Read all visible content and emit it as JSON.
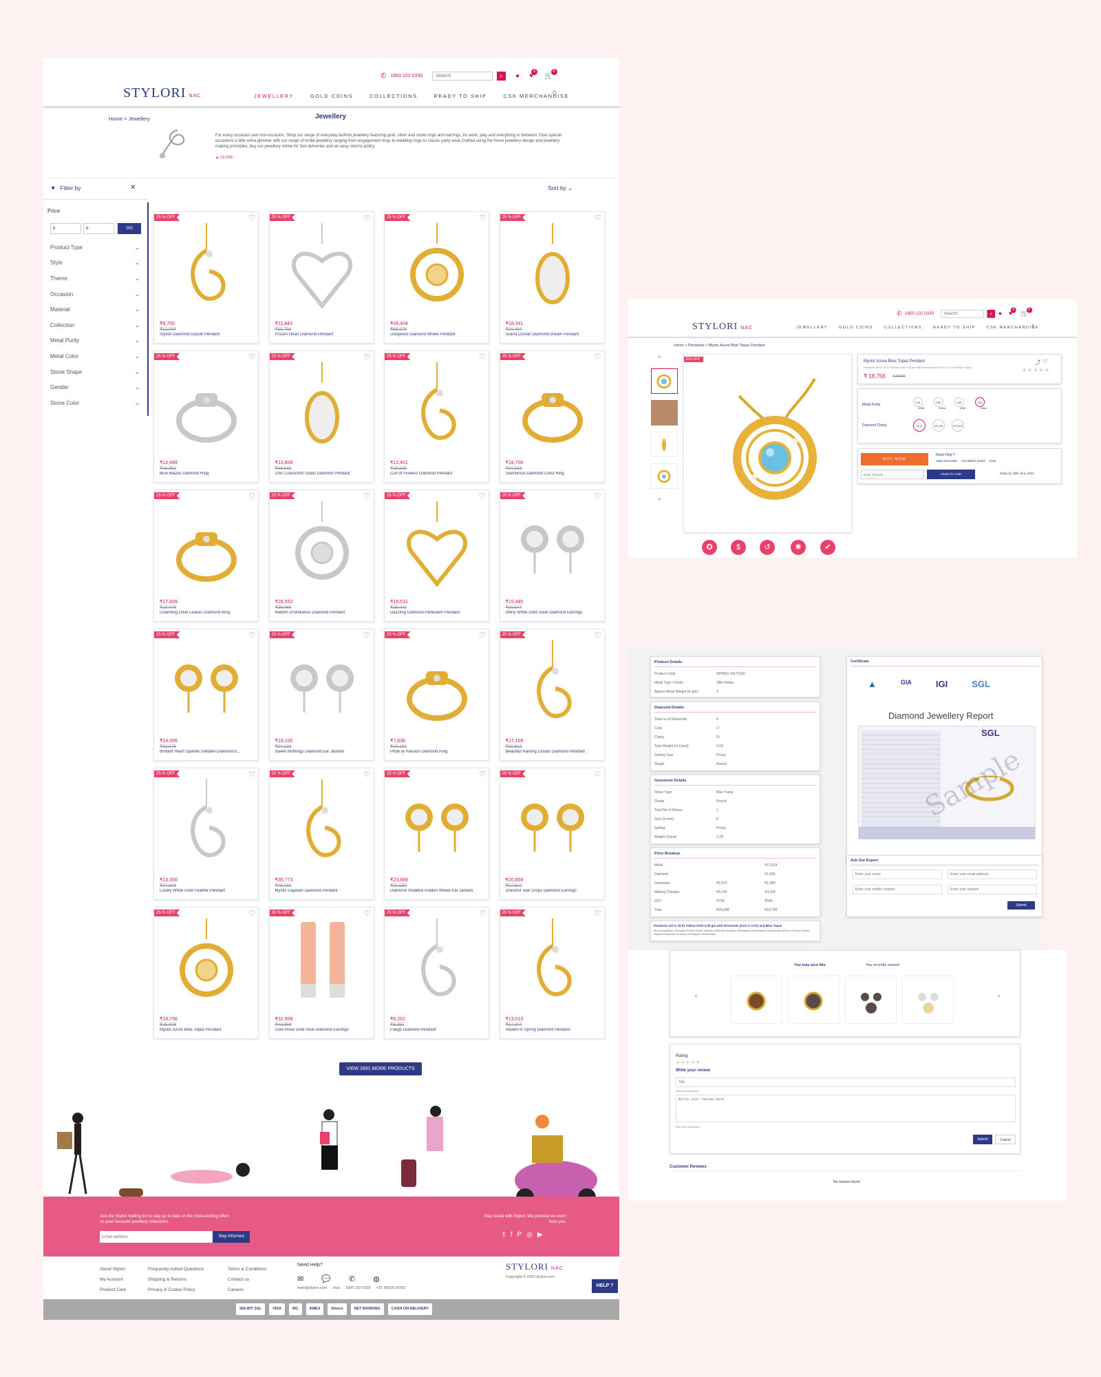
{
  "header": {
    "logo": "STYLORI",
    "logo_sub": "NAC",
    "phone": "1800 102 0330",
    "search_placeholder": "Search",
    "wishlist_count": "0",
    "cart_count": "0",
    "nav": [
      "JEWELLERY",
      "GOLD COINS",
      "COLLECTIONS",
      "READY TO SHIP",
      "CSK MERCHANDISE"
    ]
  },
  "breadcrumb": {
    "home": "Home",
    "current": "Jewellery"
  },
  "intro": {
    "title": "Jewellery",
    "text": "For every occasion and non-occasion. Shop our range of everyday fashion jewellery featuring gold, silver and stone rings and earrings, for work, play and everything in between. Give special occasions a little extra glimmer with our range of bridal jewellery ranging from engagement rings to wedding rings to classic party wear.Crafted using the finest jewellery design and jewellery making principles, buy our jewellery online for fast deliveries and an easy returns policy.",
    "close": "CLOSE"
  },
  "filter": {
    "title": "Filter by",
    "sort": "Sort by",
    "price_label": "Price",
    "min": "0",
    "max": "0",
    "go": "GO",
    "items": [
      "Product Type",
      "Style",
      "Theme",
      "Occasion",
      "Material",
      "Collection",
      "Metal Purity",
      "Metal Color",
      "Stone Shape",
      "Gender",
      "Stone Color"
    ]
  },
  "products": [
    {
      "off": "25 % OFF",
      "price": "₹9,700",
      "mrp": "₹12,934",
      "name": "Stylish Diamond Dazzle Pendant",
      "art": "pendant"
    },
    {
      "off": "25 % OFF",
      "price": "₹11,843",
      "mrp": "₹15,791",
      "name": "Frozen Heart Diamond Pendant",
      "art": "heart-silver"
    },
    {
      "off": "25 % OFF",
      "price": "₹49,404",
      "mrp": "₹65,979",
      "name": "Gorgeous Diamond Wheel Pendant",
      "art": "round"
    },
    {
      "off": "25 % OFF",
      "price": "₹18,341",
      "mrp": "₹24,454",
      "name": "Grand Cluster Diamond Dream Pendant",
      "art": "oval"
    },
    {
      "off": "25 % OFF",
      "price": "₹12,489",
      "mrp": "₹16,652",
      "name": "Blue Blazes Diamond Ring",
      "art": "ring-silver"
    },
    {
      "off": "25 % OFF",
      "price": "₹13,809",
      "mrp": "₹18,632",
      "name": "Chic Concentric Ovals Diamond Pendant",
      "art": "oval"
    },
    {
      "off": "25 % OFF",
      "price": "₹12,401",
      "mrp": "₹16,535",
      "name": "Curl of Flowers Diamond Pendant",
      "art": "pendant"
    },
    {
      "off": "25 % OFF",
      "price": "₹18,700",
      "mrp": "₹24,933",
      "name": "Glamorous Diamond Crest Ring",
      "art": "ring"
    },
    {
      "off": "25 % OFF",
      "price": "₹17,609",
      "mrp": "₹23,478",
      "name": "Charming Olive Leaves Diamond Ring",
      "art": "ring"
    },
    {
      "off": "25 % OFF",
      "price": "₹28,552",
      "mrp": "₹38,069",
      "name": "Rebirth of Brilliance Diamond Pendant",
      "art": "round-silver"
    },
    {
      "off": "25 % OFF",
      "price": "₹19,531",
      "mrp": "₹26,042",
      "name": "Dazzling Diamond Pendulum Pendant",
      "art": "heart"
    },
    {
      "off": "25 % OFF",
      "price": "₹15,485",
      "mrp": "₹20,647",
      "name": "Shiny White Gold Solar Diamond Earrings",
      "art": "earring-silver"
    },
    {
      "off": "25 % OFF",
      "price": "₹24,056",
      "mrp": "₹32,075",
      "name": "Brilliant Heart Sparkle Solitaire Diamond E...",
      "art": "earring"
    },
    {
      "off": "25 % OFF",
      "price": "₹18,100",
      "mrp": "₹24,133",
      "name": "Sweet Nothings Diamond Ear Jackets",
      "art": "earring-silver"
    },
    {
      "off": "25 % OFF",
      "price": "₹7,636",
      "mrp": "₹10,182",
      "name": "Pride of Passion Diamond Ring",
      "art": "ring"
    },
    {
      "off": "25 % OFF",
      "price": "₹17,109",
      "mrp": "₹22,812",
      "name": "Beautiful Raining Clouds Diamond Pendant",
      "art": "pendant"
    },
    {
      "off": "25 % OFF",
      "price": "₹13,356",
      "mrp": "₹17,808",
      "name": "Lovely White Gold Feather Pendant",
      "art": "pendant-silver"
    },
    {
      "off": "25 % OFF",
      "price": "₹35,773",
      "mrp": "₹48,031",
      "name": "Mystic Gajanan Diamond Pendant",
      "art": "pendant"
    },
    {
      "off": "25 % OFF",
      "price": "₹23,669",
      "mrp": "₹31,559",
      "name": "Diamond Studded Golden Wheel Ear Jackets",
      "art": "earring"
    },
    {
      "off": "25 % OFF",
      "price": "₹20,859",
      "mrp": "₹27,812",
      "name": "Graceful Tear Drops Diamond Earrings",
      "art": "earring"
    },
    {
      "off": "25 % OFF",
      "price": "₹18,756",
      "mrp": "₹25,008",
      "name": "Mystic Azure Blue Topaz Pendant",
      "art": "round"
    },
    {
      "off": "25 % OFF",
      "price": "₹32,909",
      "mrp": "₹43,959",
      "name": "Cute Rose Gold Stick Diamond Earrings",
      "art": "stick"
    },
    {
      "off": "25 % OFF",
      "price": "₹6,262",
      "mrp": "₹8,350",
      "name": "Fuego Diamond Pendant",
      "art": "pendant-silver"
    },
    {
      "off": "25 % OFF",
      "price": "₹13,010",
      "mrp": "₹17,347",
      "name": "Advent of Spring Diamond Pendant",
      "art": "pendant"
    }
  ],
  "more_button": "VIEW 2691 MORE PRODUCTS",
  "newsletter": {
    "text": "Join the Stylori mailing list to stay up to date on the most exciting offers on your favourite jewellery collections",
    "placeholder": "Email address",
    "button": "Stay Informed",
    "social_text": "Stay social with Stylori. We promise we won't bore you."
  },
  "footer": {
    "col1": [
      "About Stylori",
      "My Account",
      "Product Care"
    ],
    "col2": [
      "Frequently Asked Questions",
      "Shipping & Returns",
      "Privacy & Cookie Policy"
    ],
    "col3": [
      "Terms & Conditions",
      "Contact us",
      "Careers"
    ],
    "help_title": "Need Help?",
    "contacts": [
      "hello@stylori.com",
      "chat",
      "1800 102 0330",
      "+91 99526 25252"
    ],
    "copyright": "Copyright © 2020 stylori.com",
    "help_btn": "HELP ?",
    "payments": [
      "256-BIT SSL",
      "VISA",
      "MC",
      "AMEX",
      "Diners",
      "NET BANKING",
      "CASH ON DELIVERY"
    ]
  },
  "pdp": {
    "breadcrumb": [
      "Home",
      "Pendants",
      "Mystic Azure Blue Topaz Pendant"
    ],
    "off": "25% OFF",
    "title": "Mystic Azure Blue Topaz Pendant",
    "subtitle": "Pendants set in 18 Kt Yellow Gold 3.00 gm with Diamonds (0.03 ct U-IC) and Blue Topaz",
    "price": "₹ 18,756",
    "mrp": "₹ 25008",
    "metal_purity_label": "Metal Purity",
    "purity": [
      "14K",
      "18K",
      "18K",
      "18K"
    ],
    "purity_colors": [
      "White",
      "Yellow",
      "White",
      "Yellow"
    ],
    "clarity_label": "Diamond Clarity",
    "clarity": [
      "SI-IJ",
      "VS-GH",
      "VVS-EF"
    ],
    "buy": "BUY NOW",
    "need_help": "Need Help ?",
    "help_contacts": [
      "1800-102-0330",
      "+91 99526 25252",
      "Chat"
    ],
    "pincode": "Enter Pincode",
    "cod": "Check for COD",
    "ships": "Ships by 25th June 2021"
  },
  "details": {
    "product_title": "Product Details",
    "product_rows": [
      [
        "Product Code",
        "SP0463-18172100"
      ],
      [
        "Metal Type / Finish",
        "18kt Yellow"
      ],
      [
        "Approx Metal Weight (in gm)",
        "3"
      ]
    ],
    "diamond_title": "Diamond Details",
    "diamond_rows": [
      [
        "Total no of Diamonds",
        "6"
      ],
      [
        "Color",
        "IJ"
      ],
      [
        "Clarity",
        "SI"
      ],
      [
        "Total Weight (in Carat)",
        "0.03"
      ],
      [
        "Setting Type",
        "Prong"
      ],
      [
        "Shape",
        "Round"
      ]
    ],
    "gem_title": "Gemstone Details",
    "gem_rows": [
      [
        "Stone Type",
        "Blue Topaz"
      ],
      [
        "Shape",
        "Round"
      ],
      [
        "Total No of Stones",
        "1"
      ],
      [
        "Size (in mm)",
        "8"
      ],
      [
        "Setting",
        "Prong"
      ],
      [
        "Weight (Carat)",
        "2.28"
      ]
    ],
    "price_title": "Price Breakup",
    "price_rows": [
      [
        "Metal",
        "",
        "₹13,624"
      ],
      [
        "Diamond",
        "",
        "₹1,065"
      ],
      [
        "Gemstone",
        "₹1,072",
        "₹1,080"
      ],
      [
        "Making Charges",
        "₹4,146",
        "₹3,109"
      ],
      [
        "GST",
        "₹728",
        "₹546"
      ],
      [
        "Total",
        "₹25,008",
        "₹18,756"
      ]
    ],
    "tags_title": "Pendants set in 18 Kt Yellow Gold 3.00 gm with Diamonds (0.03 ct U-IC) and Blue Topaz",
    "tags": "#EverydayWear #Female #Yellow Stone #Sports #Special Occasion #Designer #Essentials #Gemstones #Prime #Three Stones #Sparks #Special Occasion #Designer #Essentials",
    "cert_title": "Certificate",
    "certs": [
      "BIS",
      "GIA",
      "IGI",
      "SGL"
    ],
    "report_title": "Diamond Jewellery Report",
    "watermark": "Sample",
    "ask_title": "Ask Our Expert",
    "ask_fields": [
      "Enter your name",
      "Enter your email address",
      "Enter your mobile number",
      "Enter your request"
    ],
    "ask_submit": "Submit"
  },
  "related": {
    "tab1": "You may also like",
    "tab2": "You recently viewed"
  },
  "review": {
    "rating": "Rating",
    "write": "Write your review",
    "title_ph": "Title",
    "title_hint": "Max 60 characters",
    "body_ph": "Write your review here",
    "body_hint": "Max 250 characters",
    "submit": "Submit",
    "cancel": "Cancel",
    "customer": "Customer Reviews",
    "none": "No reviews found"
  },
  "colors": {
    "brand": "#d4145a",
    "navy": "#2e3a86",
    "pink": "#e9416a",
    "gold": "#e8b23a"
  }
}
